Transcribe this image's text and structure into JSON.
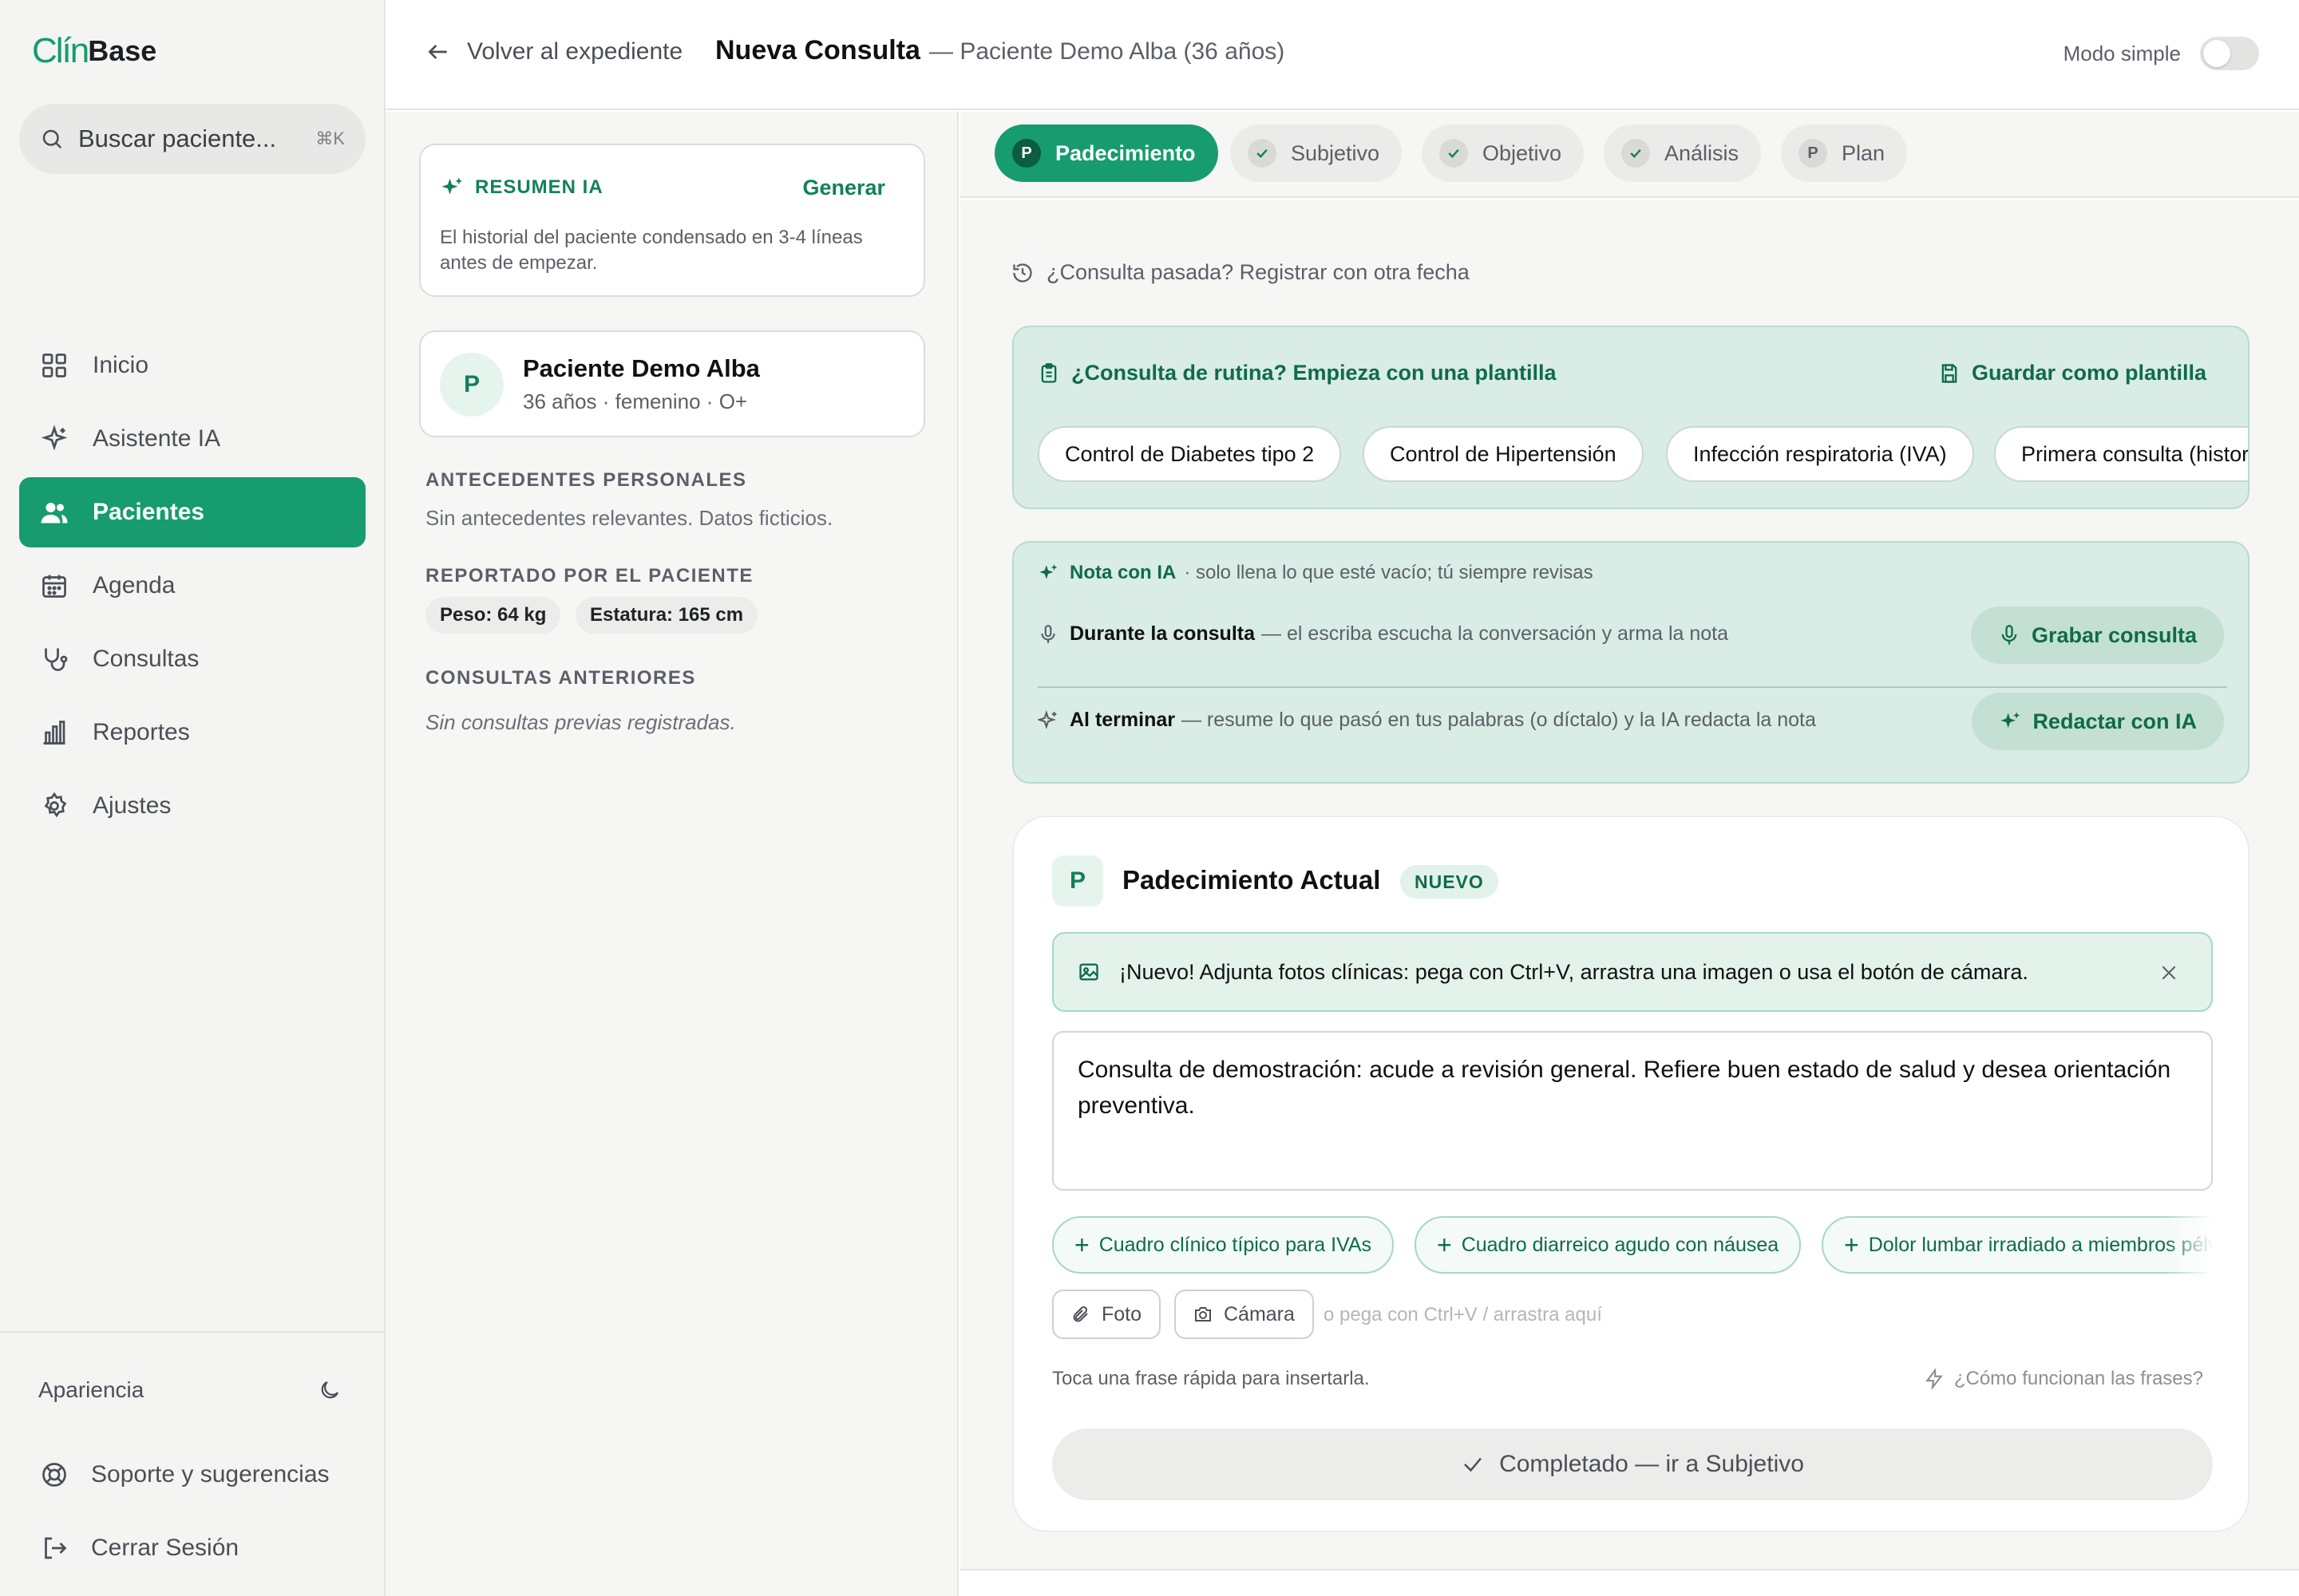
{
  "app": {
    "logo_mark": "Clín",
    "logo_text": "Base"
  },
  "search": {
    "placeholder": "Buscar paciente...",
    "shortcut": "⌘K"
  },
  "sidebar": {
    "items": [
      {
        "label": "Inicio",
        "icon": "grid-icon",
        "active": false
      },
      {
        "label": "Asistente IA",
        "icon": "sparkle-icon",
        "active": false
      },
      {
        "label": "Pacientes",
        "icon": "users-icon",
        "active": true
      },
      {
        "label": "Agenda",
        "icon": "calendar-icon",
        "active": false
      },
      {
        "label": "Consultas",
        "icon": "stethoscope-icon",
        "active": false
      },
      {
        "label": "Reportes",
        "icon": "bar-chart-icon",
        "active": false
      },
      {
        "label": "Ajustes",
        "icon": "gear-icon",
        "active": false
      }
    ],
    "appearance_label": "Apariencia",
    "support_label": "Soporte y sugerencias",
    "logout_label": "Cerrar Sesión"
  },
  "header": {
    "back_label": "Volver al expediente",
    "title": "Nueva Consulta",
    "subtitle": "— Paciente Demo Alba (36 años)",
    "simple_mode_label": "Modo simple",
    "simple_mode_on": false
  },
  "summary": {
    "title": "RESUMEN IA",
    "action": "Generar",
    "description": "El historial del paciente condensado en 3-4 líneas antes de empezar."
  },
  "patient": {
    "initial": "P",
    "name": "Paciente Demo Alba",
    "meta": "36 años · femenino · O+"
  },
  "history": {
    "personal_title": "ANTECEDENTES PERSONALES",
    "personal_text": "Sin antecedentes relevantes. Datos ficticios.",
    "reported_title": "REPORTADO POR EL PACIENTE",
    "weight": "Peso: 64 kg",
    "height": "Estatura: 165 cm",
    "previous_title": "CONSULTAS ANTERIORES",
    "previous_text": "Sin consultas previas registradas."
  },
  "tabs": [
    {
      "badge": "P",
      "label": "Padecimiento",
      "active": true,
      "done": false
    },
    {
      "badge": "✓",
      "label": "Subjetivo",
      "active": false,
      "done": true
    },
    {
      "badge": "✓",
      "label": "Objetivo",
      "active": false,
      "done": true
    },
    {
      "badge": "✓",
      "label": "Análisis",
      "active": false,
      "done": true
    },
    {
      "badge": "P",
      "label": "Plan",
      "active": false,
      "done": false
    }
  ],
  "past_consult_label": "¿Consulta pasada? Registrar con otra fecha",
  "templates": {
    "title": "¿Consulta de rutina? Empieza con una plantilla",
    "save_label": "Guardar como plantilla",
    "chips": [
      "Control de Diabetes tipo 2",
      "Control de Hipertensión",
      "Infección respiratoria (IVA)",
      "Primera consulta (historia clínica)"
    ]
  },
  "ai_note": {
    "title": "Nota con IA",
    "subtitle": "· solo llena lo que esté vacío; tú siempre revisas",
    "during_label": "Durante la consulta",
    "during_text": "— el escriba escucha la conversación y arma la nota",
    "record_button": "Grabar consulta",
    "after_label": "Al terminar",
    "after_text": "— resume lo que pasó en tus palabras (o díctalo) y la IA redacta la nota",
    "draft_button": "Redactar con IA"
  },
  "padecimiento": {
    "badge": "P",
    "title": "Padecimiento Actual",
    "new_tag": "NUEVO",
    "banner": "¡Nuevo! Adjunta fotos clínicas: pega con Ctrl+V, arrastra una imagen o usa el botón de cámara.",
    "text": "Consulta de demostración: acude a revisión general. Refiere buen estado de salud y desea orientación preventiva.",
    "phrases": [
      "Cuadro clínico típico para IVAs",
      "Cuadro diarreico agudo con náusea",
      "Dolor lumbar irradiado a miembros pélvicos"
    ],
    "photo_label": "Foto",
    "camera_label": "Cámara",
    "paste_hint": "o pega con Ctrl+V / arrastra aquí",
    "tap_hint": "Toca una frase rápida para insertarla.",
    "how_label": "¿Cómo funcionan las frases?",
    "complete_label": "Completado — ir a Subjetivo"
  },
  "colors": {
    "accent": "#169c6e",
    "accent_dark": "#0f6b4b",
    "tint": "#d9ece5"
  }
}
